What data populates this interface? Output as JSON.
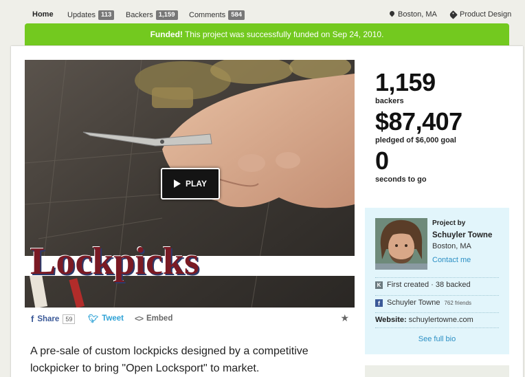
{
  "nav": {
    "items": [
      {
        "label": "Home",
        "count": ""
      },
      {
        "label": "Updates",
        "count": "113"
      },
      {
        "label": "Backers",
        "count": "1,159"
      },
      {
        "label": "Comments",
        "count": "584"
      }
    ],
    "location": "Boston, MA",
    "category": "Product Design"
  },
  "banner": {
    "strong": "Funded!",
    "text": "This project was successfully funded on Sep 24, 2010."
  },
  "video": {
    "title_text": "Lockpicks",
    "play_label": "PLAY"
  },
  "share": {
    "share_label": "Share",
    "share_count": "59",
    "tweet_label": "Tweet",
    "embed_label": "Embed"
  },
  "description": "A pre-sale of custom lockpicks designed by a competitive lockpicker to bring \"Open Locksport\" to market.",
  "stats": {
    "backers_value": "1,159",
    "backers_label": "backers",
    "pledged_value": "$87,407",
    "pledged_label": "pledged of $6,000 goal",
    "time_value": "0",
    "time_label": "seconds to go"
  },
  "creator": {
    "project_by": "Project by",
    "name": "Schuyler Towne",
    "location": "Boston, MA",
    "contact": "Contact me",
    "history": "First created · 38 backed",
    "fb_name": "Schuyler Towne",
    "fb_friends": "762 friends",
    "website_label": "Website:",
    "website": "schuylertowne.com",
    "full_bio": "See full bio"
  },
  "colors": {
    "funded_green": "#73c91f",
    "link_blue": "#2b8fc4",
    "facebook_blue": "#3b5998",
    "twitter_blue": "#2ea2d6"
  },
  "icons": [
    "location-pin-icon",
    "tag-icon",
    "play-icon",
    "facebook-icon",
    "twitter-icon",
    "embed-icon",
    "star-icon",
    "kickstarter-icon"
  ]
}
